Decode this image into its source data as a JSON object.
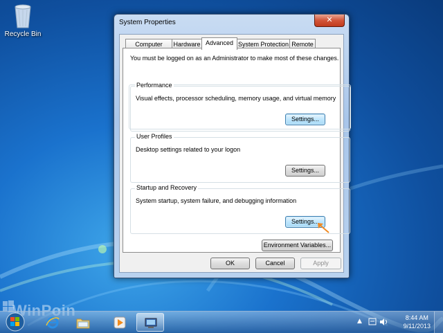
{
  "desktop": {
    "recycle_bin_label": "Recycle Bin",
    "watermark": "WinPoin"
  },
  "window": {
    "title": "System Properties",
    "close_glyph": "✕",
    "tabs": [
      {
        "label": "Computer Name",
        "active": false
      },
      {
        "label": "Hardware",
        "active": false
      },
      {
        "label": "Advanced",
        "active": true
      },
      {
        "label": "System Protection",
        "active": false
      },
      {
        "label": "Remote",
        "active": false
      }
    ],
    "notice": "You must be logged on as an Administrator to make most of these changes.",
    "groups": {
      "performance": {
        "title": "Performance",
        "description": "Visual effects, processor scheduling, memory usage, and virtual memory",
        "button": "Settings..."
      },
      "user_profiles": {
        "title": "User Profiles",
        "description": "Desktop settings related to your logon",
        "button": "Settings..."
      },
      "startup_recovery": {
        "title": "Startup and Recovery",
        "description": "System startup, system failure, and debugging information",
        "button": "Settings..."
      }
    },
    "environment_button": "Environment Variables...",
    "footer": {
      "ok": "OK",
      "cancel": "Cancel",
      "apply": "Apply"
    }
  },
  "taskbar": {
    "clock_time": "8:44 AM",
    "clock_date": "9/11/2013",
    "tray_up_arrow": "▲"
  },
  "colors": {
    "highlight_arrow": "#f08a24",
    "focus_border": "#3c7fb1"
  }
}
